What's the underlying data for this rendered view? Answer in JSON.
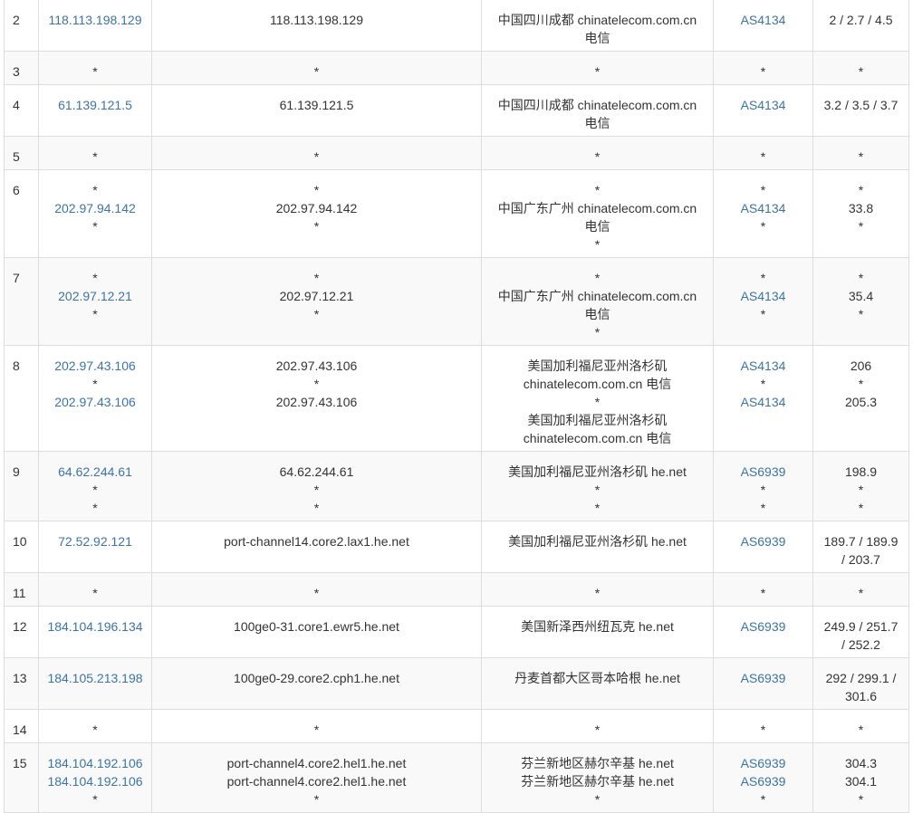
{
  "colors": {
    "link": "#3b74a7",
    "text": "#333333",
    "border": "#dddddd",
    "stripe": "#f9f9f9"
  },
  "rows": [
    {
      "hop": "2",
      "ip": [
        "118.113.198.129"
      ],
      "host": [
        "118.113.198.129"
      ],
      "location": [
        "中国四川成都 chinatelecom.com.cn",
        "电信"
      ],
      "asn": [
        "AS4134"
      ],
      "time": [
        "2 / 2.7 / 4.5"
      ]
    },
    {
      "hop": "3",
      "ip": [
        "*"
      ],
      "host": [
        "*"
      ],
      "location": [
        "*"
      ],
      "asn": [
        "*"
      ],
      "time": [
        "*"
      ]
    },
    {
      "hop": "4",
      "ip": [
        "61.139.121.5"
      ],
      "host": [
        "61.139.121.5"
      ],
      "location": [
        "中国四川成都 chinatelecom.com.cn",
        "电信"
      ],
      "asn": [
        "AS4134"
      ],
      "time": [
        "3.2 / 3.5 / 3.7"
      ]
    },
    {
      "hop": "5",
      "ip": [
        "*"
      ],
      "host": [
        "*"
      ],
      "location": [
        "*"
      ],
      "asn": [
        "*"
      ],
      "time": [
        "*"
      ]
    },
    {
      "hop": "6",
      "ip": [
        "*",
        "202.97.94.142",
        "*"
      ],
      "host": [
        "*",
        "202.97.94.142",
        "*"
      ],
      "location": [
        "*",
        "中国广东广州 chinatelecom.com.cn",
        "电信",
        "*"
      ],
      "asn": [
        "*",
        "AS4134",
        "*"
      ],
      "time": [
        "*",
        "33.8",
        "*"
      ]
    },
    {
      "hop": "7",
      "ip": [
        "*",
        "202.97.12.21",
        "*"
      ],
      "host": [
        "*",
        "202.97.12.21",
        "*"
      ],
      "location": [
        "*",
        "中国广东广州 chinatelecom.com.cn",
        "电信",
        "*"
      ],
      "asn": [
        "*",
        "AS4134",
        "*"
      ],
      "time": [
        "*",
        "35.4",
        "*"
      ]
    },
    {
      "hop": "8",
      "ip": [
        "202.97.43.106",
        "*",
        "202.97.43.106"
      ],
      "host": [
        "202.97.43.106",
        "*",
        "202.97.43.106"
      ],
      "location": [
        "美国加利福尼亚州洛杉矶",
        "chinatelecom.com.cn 电信",
        "*",
        "美国加利福尼亚州洛杉矶",
        "chinatelecom.com.cn 电信"
      ],
      "asn": [
        "AS4134",
        "*",
        "AS4134"
      ],
      "time": [
        "206",
        "*",
        "205.3"
      ]
    },
    {
      "hop": "9",
      "ip": [
        "64.62.244.61",
        "*",
        "*"
      ],
      "host": [
        "64.62.244.61",
        "*",
        "*"
      ],
      "location": [
        "美国加利福尼亚州洛杉矶 he.net",
        "*",
        "*"
      ],
      "asn": [
        "AS6939",
        "*",
        "*"
      ],
      "time": [
        "198.9",
        "*",
        "*"
      ]
    },
    {
      "hop": "10",
      "ip": [
        "72.52.92.121"
      ],
      "host": [
        "port-channel14.core2.lax1.he.net"
      ],
      "location": [
        "美国加利福尼亚州洛杉矶 he.net"
      ],
      "asn": [
        "AS6939"
      ],
      "time": [
        "189.7 / 189.9",
        "/ 203.7"
      ]
    },
    {
      "hop": "11",
      "ip": [
        "*"
      ],
      "host": [
        "*"
      ],
      "location": [
        "*"
      ],
      "asn": [
        "*"
      ],
      "time": [
        "*"
      ]
    },
    {
      "hop": "12",
      "ip": [
        "184.104.196.134"
      ],
      "host": [
        "100ge0-31.core1.ewr5.he.net"
      ],
      "location": [
        "美国新泽西州纽瓦克 he.net"
      ],
      "asn": [
        "AS6939"
      ],
      "time": [
        "249.9 / 251.7",
        "/ 252.2"
      ]
    },
    {
      "hop": "13",
      "ip": [
        "184.105.213.198"
      ],
      "host": [
        "100ge0-29.core2.cph1.he.net"
      ],
      "location": [
        "丹麦首都大区哥本哈根 he.net"
      ],
      "asn": [
        "AS6939"
      ],
      "time": [
        "292 / 299.1 /",
        "301.6"
      ]
    },
    {
      "hop": "14",
      "ip": [
        "*"
      ],
      "host": [
        "*"
      ],
      "location": [
        "*"
      ],
      "asn": [
        "*"
      ],
      "time": [
        "*"
      ]
    },
    {
      "hop": "15",
      "ip": [
        "184.104.192.106",
        "184.104.192.106",
        "*"
      ],
      "host": [
        "port-channel4.core2.hel1.he.net",
        "port-channel4.core2.hel1.he.net",
        "*"
      ],
      "location": [
        "芬兰新地区赫尔辛基 he.net",
        "芬兰新地区赫尔辛基 he.net",
        "*"
      ],
      "asn": [
        "AS6939",
        "AS6939",
        "*"
      ],
      "time": [
        "304.3",
        "304.1",
        "*"
      ]
    }
  ]
}
